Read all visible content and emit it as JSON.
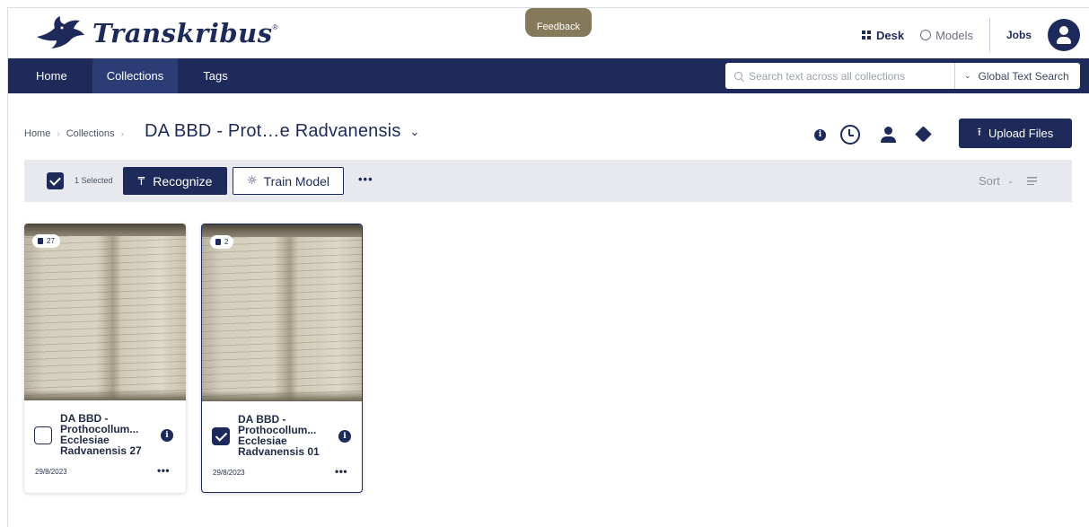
{
  "brand": {
    "name": "Transkribus",
    "mark": "®"
  },
  "feedback": {
    "label": "Feedback"
  },
  "top_nav": {
    "desk": "Desk",
    "models": "Models",
    "jobs": "Jobs"
  },
  "nav": {
    "items": [
      {
        "label": "Home",
        "active": false
      },
      {
        "label": "Collections",
        "active": true
      },
      {
        "label": "Tags",
        "active": false
      }
    ]
  },
  "search": {
    "placeholder": "Search text across all collections",
    "mode": "Global Text Search"
  },
  "breadcrumb": {
    "home": "Home",
    "collections": "Collections"
  },
  "page": {
    "title": "DA BBD - Prot…e Radvanensis"
  },
  "actions": {
    "upload": "Upload Files"
  },
  "toolbar": {
    "selected": "1 Selected",
    "recognize": "Recognize",
    "train": "Train Model",
    "more": "•••",
    "sort": "Sort"
  },
  "cards": [
    {
      "pages": "27",
      "title_lines": [
        "DA BBD -",
        "Prothocollum...",
        "Ecclesiae",
        "Radvanensis 27"
      ],
      "date": "29/8/2023",
      "selected": false,
      "more": "•••"
    },
    {
      "pages": "2",
      "title_lines": [
        "DA BBD -",
        "Prothocollum...",
        "Ecclesiae",
        "Radvanensis 01"
      ],
      "date": "29/8/2023",
      "selected": true,
      "more": "•••"
    }
  ],
  "colors": {
    "navy": "#1d2a5a",
    "feedback": "#84795a",
    "toolbar_bg": "#e7e9ee"
  }
}
